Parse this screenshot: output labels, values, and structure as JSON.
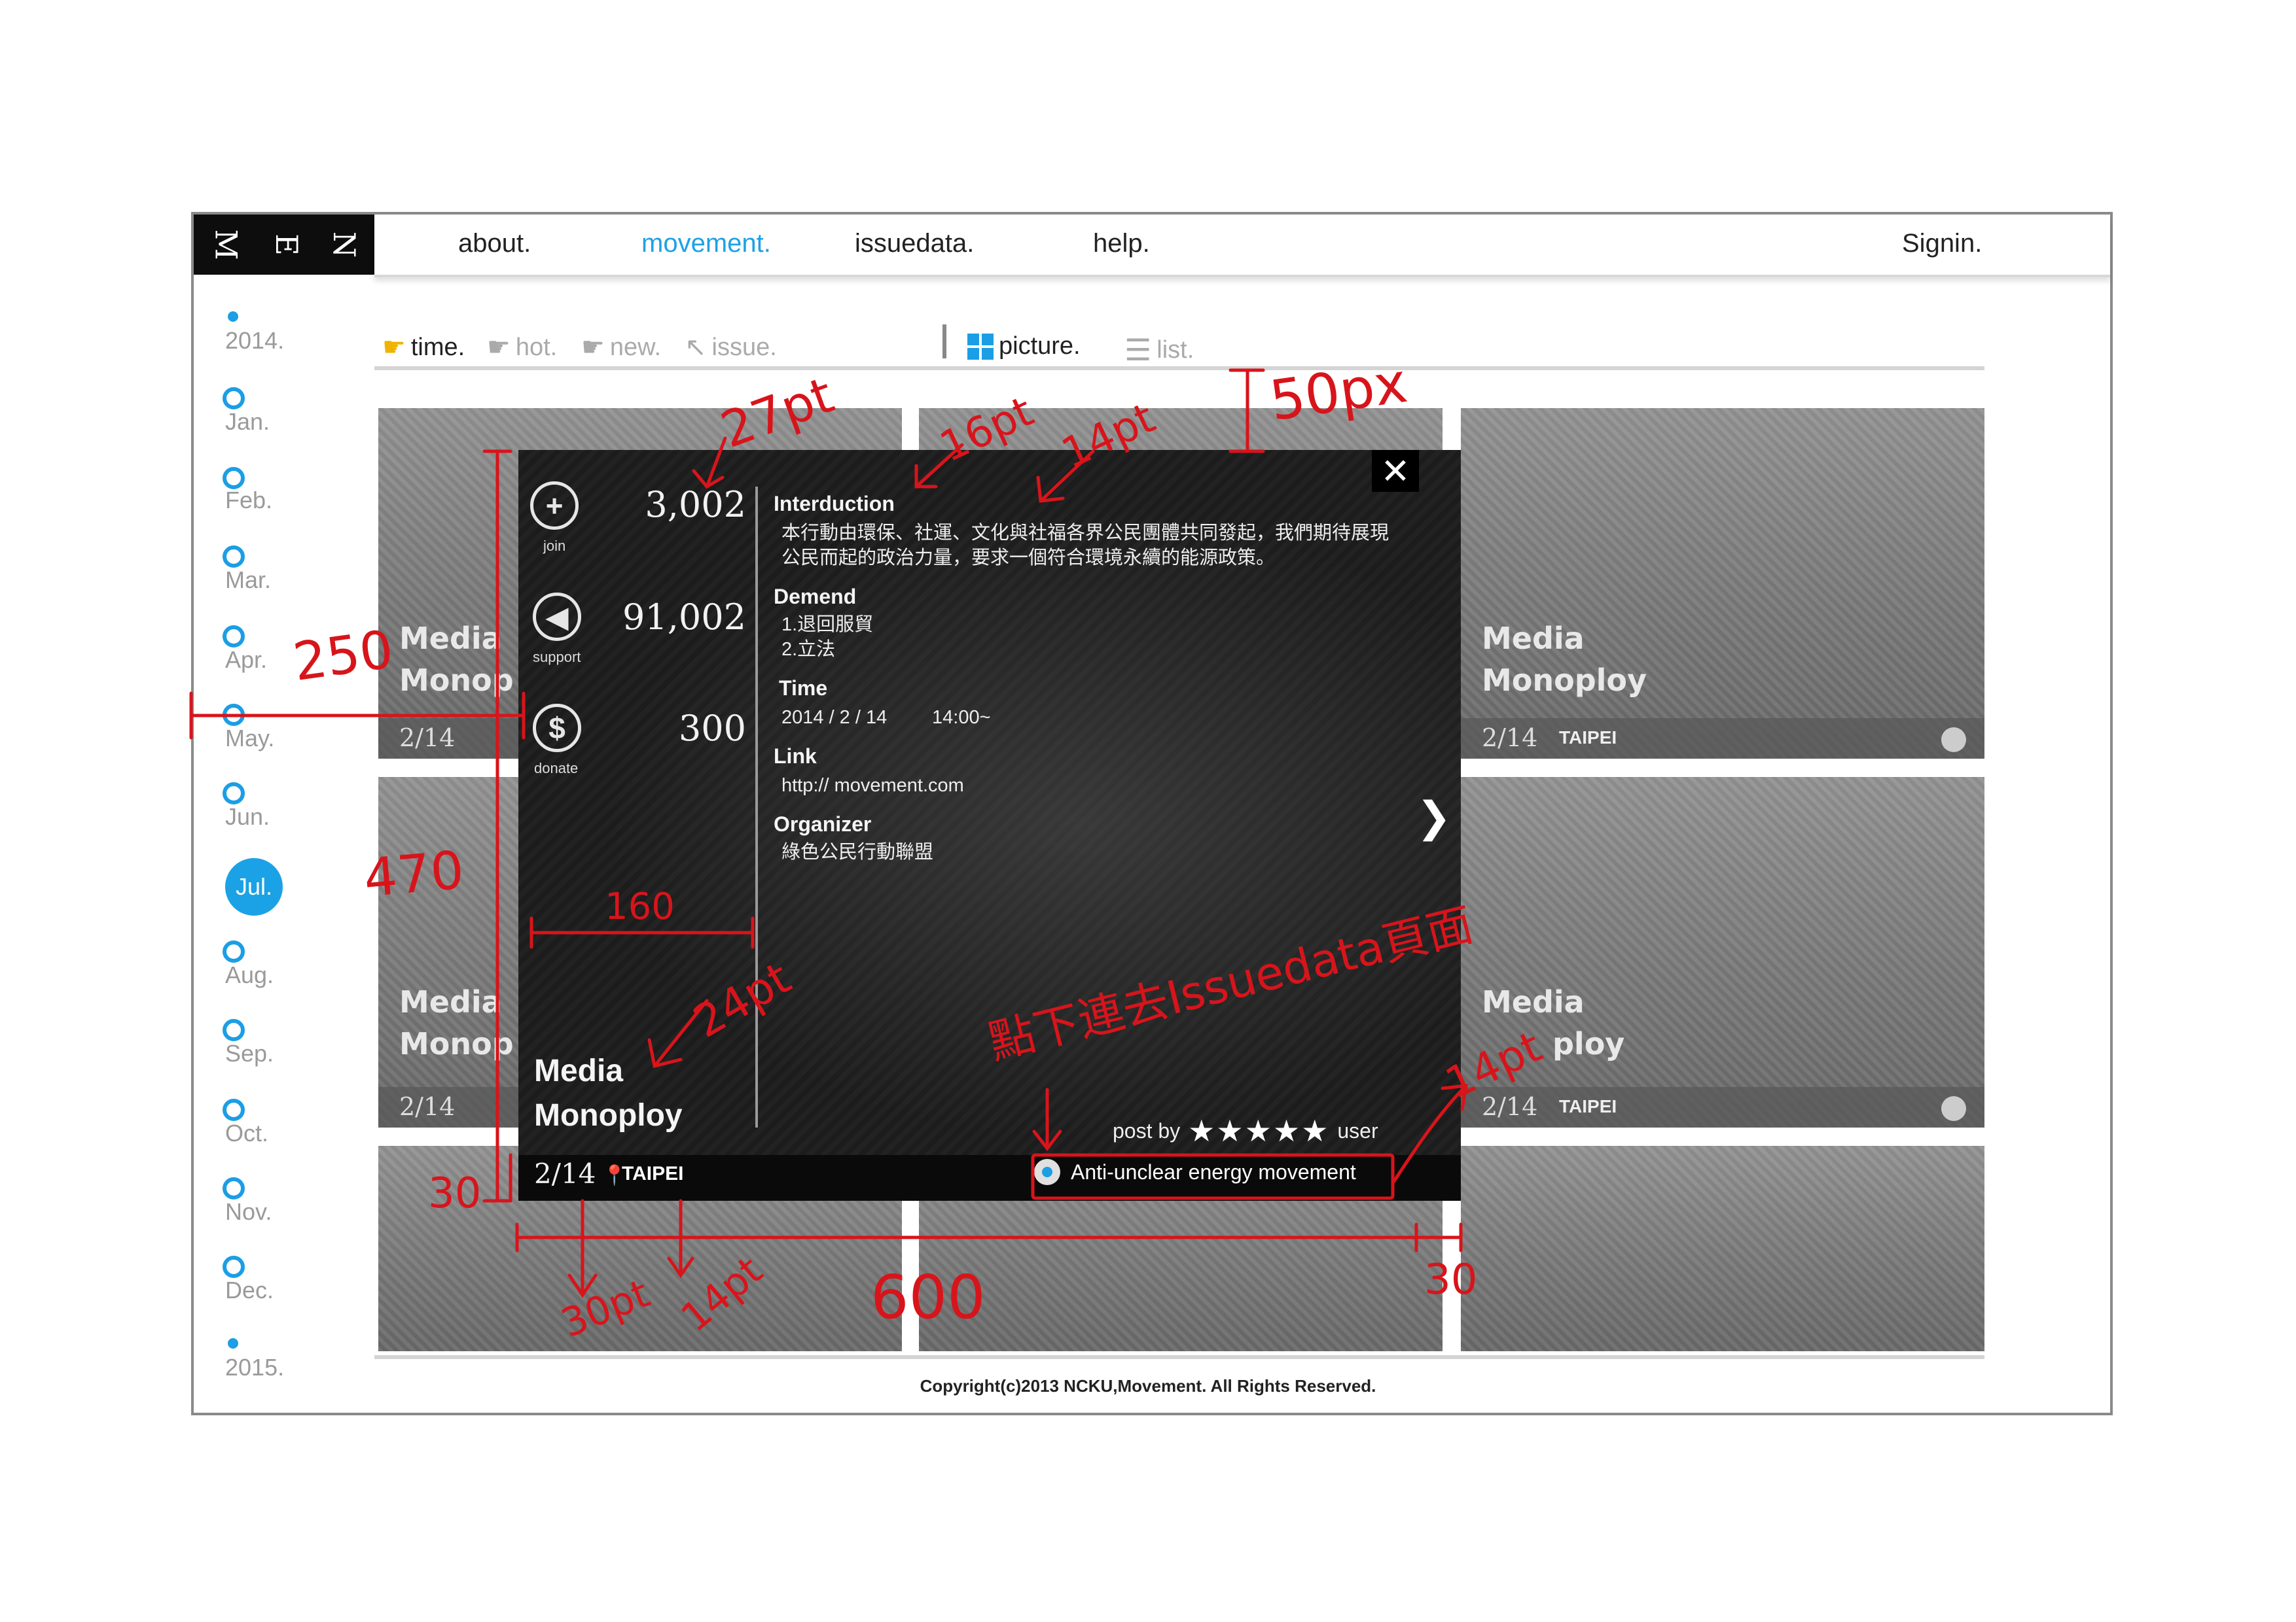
{
  "logo": {
    "letters": [
      "M",
      "E",
      "N"
    ]
  },
  "nav": {
    "about": "about.",
    "movement": "movement.",
    "issuedata": "issuedata.",
    "help": "help.",
    "signin": "Signin."
  },
  "timeline": {
    "year_start": "2014.",
    "months": [
      "Jan.",
      "Feb.",
      "Mar.",
      "Apr.",
      "May.",
      "Jun.",
      "Jul.",
      "Aug.",
      "Sep.",
      "Oct.",
      "Nov.",
      "Dec."
    ],
    "active_month": "Jul.",
    "year_end": "2015."
  },
  "filters": {
    "time": "time.",
    "hot": "hot.",
    "new": "new.",
    "issue": "issue.",
    "picture": "picture.",
    "list": "list."
  },
  "tiles": {
    "title_line1": "Media",
    "title_line2": "Monoploy",
    "title_line2_clipped": "Monop",
    "title_line2_right": "ploy",
    "date": "2/14",
    "city": "TAIPEI"
  },
  "modal": {
    "join": {
      "value": "3,002",
      "label": "join"
    },
    "support": {
      "value": "91,002",
      "label": "support"
    },
    "donate": {
      "value": "300",
      "label": "donate"
    },
    "intro_h": "Interduction",
    "intro_1": "本行動由環保、社運、文化與社福各界公民團體共同發起，我們期待展現",
    "intro_2": "公民而起的政治力量，要求一個符合環境永續的能源政策。",
    "demand_h": "Demend",
    "demand_1": "1.退回服貿",
    "demand_2": "2.立法",
    "time_h": "Time",
    "time_date": "2014 / 2 / 14",
    "time_clock": "14:00~",
    "link_h": "Link",
    "link": "http:// movement.com",
    "org_h": "Organizer",
    "org": "綠色公民行動聯盟",
    "title_1": "Media",
    "title_2": "Monoploy",
    "date": "2/14",
    "city": "TAIPEI",
    "post_by": "post by",
    "stars": "★★★★★",
    "user": "user",
    "issue": "Anti-unclear energy movement"
  },
  "copyright": "Copyright(c)2013 NCKU,Movement. All Rights Reserved.",
  "annotations": {
    "pt27": "27pt",
    "pt16": "16pt",
    "pt14": "14pt",
    "px50": "50px",
    "w250": "250",
    "h470": "470",
    "w160": "160",
    "pt24": "24pt",
    "h30": "30",
    "pt30": "30pt",
    "pt14b": "14pt",
    "w600": "600",
    "w30": "30",
    "note": "點下連去Issuedata頁面",
    "pt14c": "14pt"
  },
  "colors": {
    "accent": "#1b9ee5",
    "annotation": "#d8141b",
    "modal_bg": "#1c1c1c",
    "logo_bg": "#0d0d0d"
  }
}
